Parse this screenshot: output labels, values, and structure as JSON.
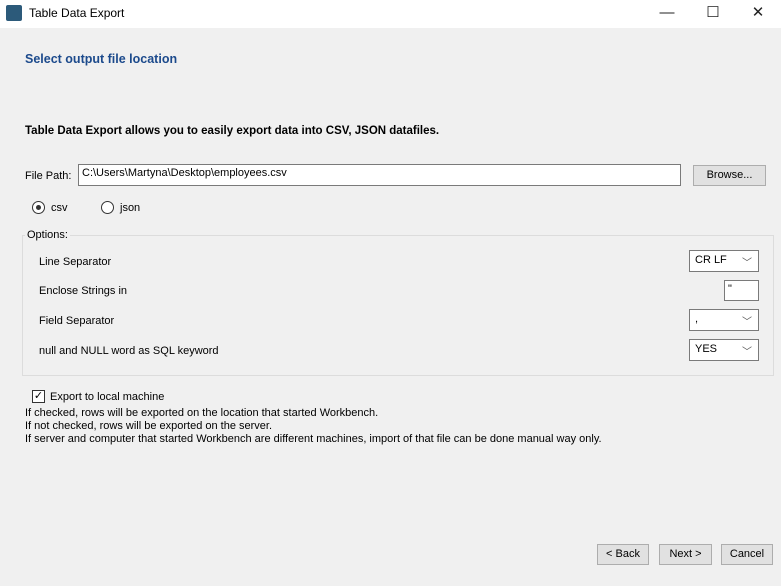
{
  "window": {
    "title": "Table Data Export",
    "minimize": "—",
    "maximize": "☐",
    "close": "✕"
  },
  "heading": "Select output file location",
  "intro": "Table Data Export allows you to easily export data into CSV, JSON datafiles.",
  "file_path": {
    "label": "File Path:",
    "value": "C:\\Users\\Martyna\\Desktop\\employees.csv",
    "browse": "Browse..."
  },
  "format": {
    "csv": "csv",
    "json": "json",
    "selected": "csv"
  },
  "options": {
    "title": "Options:",
    "line_separator": {
      "label": "Line Separator",
      "value": "CR LF"
    },
    "enclose_strings": {
      "label": "Enclose Strings in",
      "value": "\""
    },
    "field_separator": {
      "label": "Field Separator",
      "value": ","
    },
    "null_keyword": {
      "label": "null and NULL word as SQL keyword",
      "value": "YES"
    }
  },
  "export_local": {
    "label": "Export to local machine",
    "checked": true,
    "help": [
      "If checked, rows will be exported on the location that started Workbench.",
      "If not checked, rows will be exported on the server.",
      "If server and computer that started Workbench are different machines, import of that file can be done manual way only."
    ]
  },
  "buttons": {
    "back": "< Back",
    "next": "Next >",
    "cancel": "Cancel"
  }
}
